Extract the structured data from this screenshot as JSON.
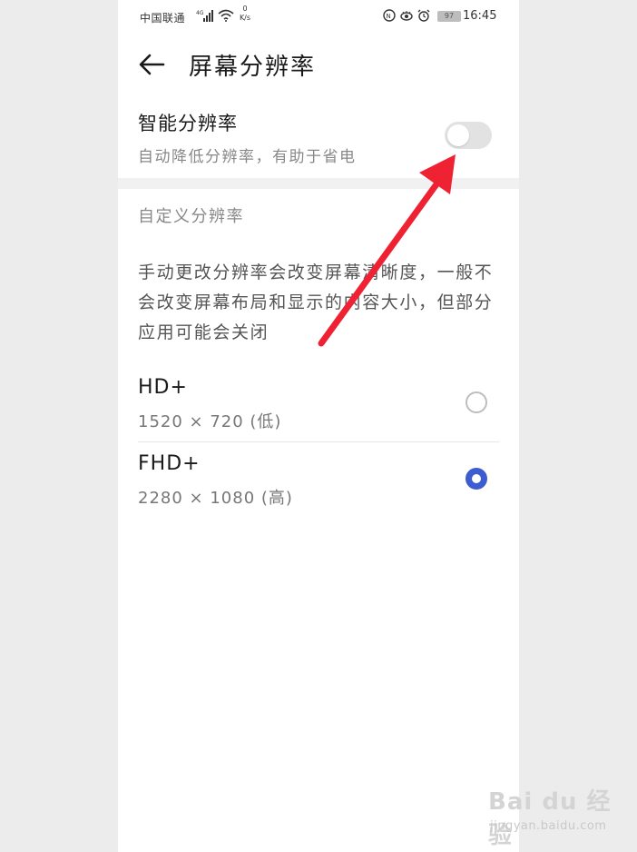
{
  "status_bar": {
    "carrier": "中国联通",
    "speed_value": "0",
    "speed_unit": "K/s",
    "battery": "97",
    "time": "16:45"
  },
  "header": {
    "title": "屏幕分辨率",
    "back_icon": "arrow-left-icon"
  },
  "smart_resolution": {
    "title": "智能分辨率",
    "subtitle": "自动降低分辨率，有助于省电",
    "enabled": false
  },
  "custom_section": {
    "title": "自定义分辨率",
    "description": "手动更改分辨率会改变屏幕清晰度，一般不会改变屏幕布局和显示的内容大小，但部分应用可能会关闭"
  },
  "resolution_options": [
    {
      "name": "HD+",
      "detail": "1520 × 720 (低)",
      "selected": false
    },
    {
      "name": "FHD+",
      "detail": "2280 × 1080 (高)",
      "selected": true
    }
  ],
  "annotation": {
    "color": "#ee2233"
  },
  "watermark": {
    "logo": "Bai du 经验",
    "url": "jingyan.baidu.com"
  },
  "colors": {
    "accent": "#3d5ccf",
    "toggle_off": "#e2e2e2"
  }
}
